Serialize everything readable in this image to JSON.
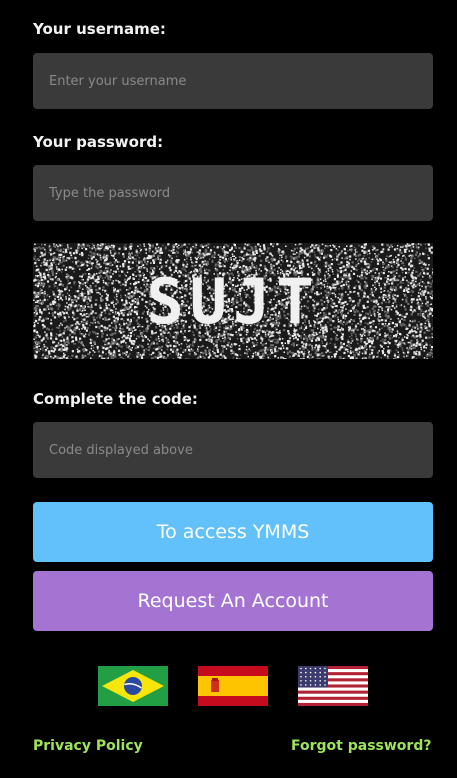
{
  "form": {
    "username_label": "Your username:",
    "username_placeholder": "Enter your username",
    "username_value": "",
    "password_label": "Your password:",
    "password_placeholder": "Type the password",
    "password_value": "",
    "captcha_text": "SUJT",
    "code_label": "Complete the code:",
    "code_placeholder": "Code displayed above",
    "code_value": ""
  },
  "buttons": {
    "access_label": "To access YMMS",
    "request_label": "Request An Account"
  },
  "languages": [
    {
      "name": "brazil-flag-icon"
    },
    {
      "name": "spain-flag-icon"
    },
    {
      "name": "usa-flag-icon"
    }
  ],
  "footer": {
    "privacy_label": "Privacy Policy",
    "forgot_label": "Forgot password?"
  },
  "colors": {
    "background": "#000000",
    "field_bg": "#3a3a3a",
    "primary_button": "#62c1fb",
    "secondary_button": "#a574d2",
    "link": "#9ee35a"
  }
}
